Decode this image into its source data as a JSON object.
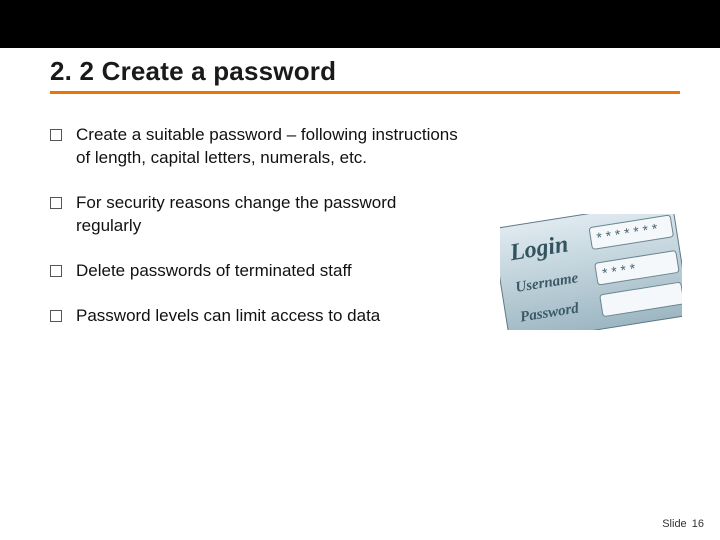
{
  "heading": "2. 2 Create a password",
  "bullets": [
    "Create a suitable password – following instructions of length, capital letters, numerals, etc.",
    "For security reasons change the password regularly",
    "Delete passwords of terminated staff",
    "Password levels can limit access to data"
  ],
  "illustration": {
    "login_label": "Login",
    "username_label": "Username",
    "password_label": "Password",
    "mask1": "* * * * * * *",
    "mask2": "* * * *"
  },
  "footer": {
    "label": "Slide",
    "number": "16"
  },
  "colors": {
    "accent": "#EC7404",
    "topbar": "#000000"
  }
}
